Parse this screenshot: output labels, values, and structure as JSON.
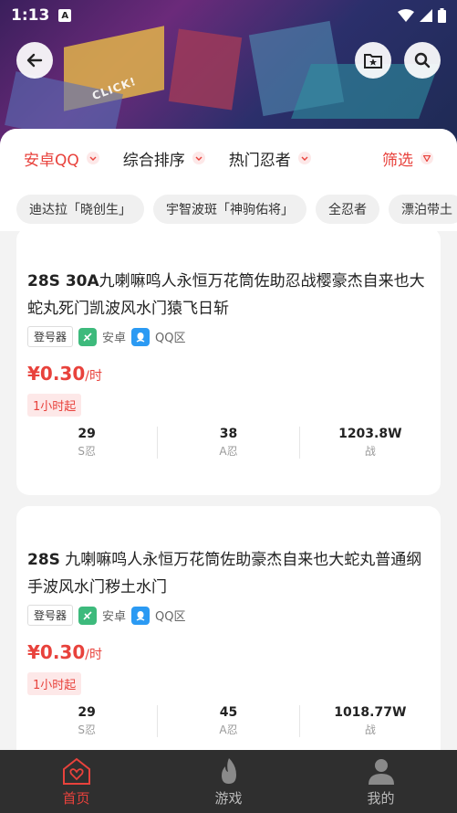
{
  "status": {
    "time": "1:13",
    "a_badge": "A"
  },
  "banner": {
    "decor_text": "CLICK!"
  },
  "filters": [
    {
      "label": "安卓QQ"
    },
    {
      "label": "综合排序"
    },
    {
      "label": "热门忍者"
    },
    {
      "label": "筛选"
    }
  ],
  "tags": [
    "迪达拉「晓创生」",
    "宇智波斑「神驹佑将」",
    "全忍者",
    "漂泊带土"
  ],
  "listings": [
    {
      "title_bold": "28S 30A",
      "title_rest": "九喇嘛鸣人永恒万花筒佐助忍战樱豪杰自来也大蛇丸死门凯波风水门猿飞日斩",
      "login": "登号器",
      "platform": "安卓",
      "zone": "QQ区",
      "price_symbol": "¥",
      "price": "0.30",
      "price_unit": "/时",
      "min_rent": "1小时起",
      "stats": [
        {
          "value": "29",
          "label": "S忍"
        },
        {
          "value": "38",
          "label": "A忍"
        },
        {
          "value": "1203.8W",
          "label": "战"
        }
      ]
    },
    {
      "title_bold": "28S",
      "title_rest": " 九喇嘛鸣人永恒万花筒佐助豪杰自来也大蛇丸普通纲手波风水门秽土水门",
      "login": "登号器",
      "platform": "安卓",
      "zone": "QQ区",
      "price_symbol": "¥",
      "price": "0.30",
      "price_unit": "/时",
      "min_rent": "1小时起",
      "stats": [
        {
          "value": "29",
          "label": "S忍"
        },
        {
          "value": "45",
          "label": "A忍"
        },
        {
          "value": "1018.77W",
          "label": "战"
        }
      ]
    }
  ],
  "nav": [
    {
      "label": "首页"
    },
    {
      "label": "游戏"
    },
    {
      "label": "我的"
    }
  ],
  "colors": {
    "accent": "#e8423c",
    "nav_bg": "#2f2f2f"
  }
}
